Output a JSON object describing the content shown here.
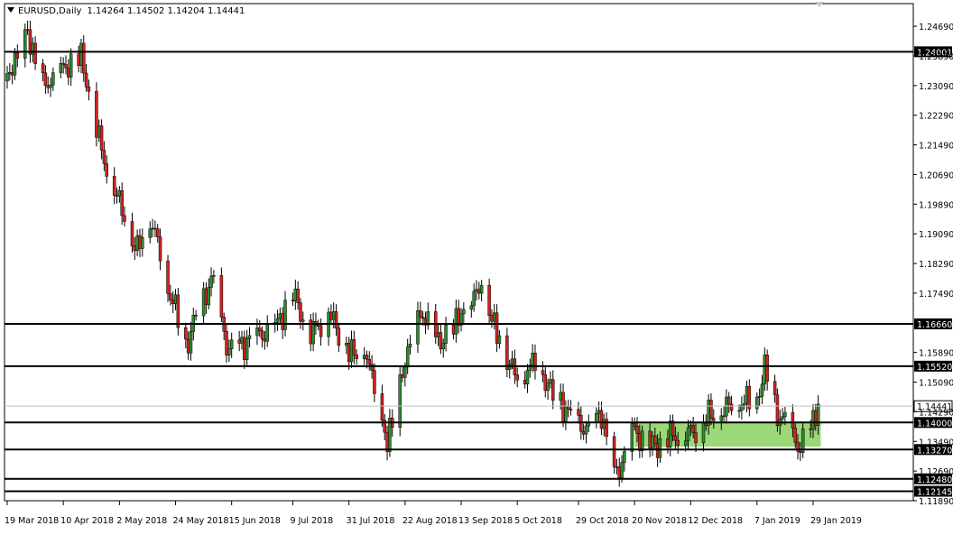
{
  "header": {
    "symbol": "EURUSD,Daily",
    "ohlc": "1.14264 1.14502 1.14204 1.14441"
  },
  "colors": {
    "bull": "#2e8b2e",
    "bear": "#d42020",
    "zone": "#90d468",
    "level": "#000000",
    "price_line": "#c0c0c0"
  },
  "chart_data": {
    "type": "candlestick",
    "ylim": [
      1.1189,
      1.253
    ],
    "y_ticks": [
      "1.24690",
      "1.23890",
      "1.23090",
      "1.22290",
      "1.21490",
      "1.20690",
      "1.19890",
      "1.19090",
      "1.18290",
      "1.17490",
      "1.15890",
      "1.15090",
      "1.14290",
      "1.13490",
      "1.12690",
      "1.11890"
    ],
    "x_ticks": [
      "19 Mar 2018",
      "10 Apr 2018",
      "2 May 2018",
      "24 May 2018",
      "15 Jun 2018",
      "9 Jul 2018",
      "31 Jul 2018",
      "22 Aug 2018",
      "13 Sep 2018",
      "5 Oct 2018",
      "29 Oct 2018",
      "20 Nov 2018",
      "12 Dec 2018",
      "7 Jan 2019",
      "29 Jan 2019"
    ],
    "levels": [
      {
        "value": 1.24001,
        "label": "1.24001"
      },
      {
        "value": 1.1666,
        "label": "1.16660"
      },
      {
        "value": 1.1552,
        "label": "1.15520"
      },
      {
        "value": 1.14,
        "label": "1.14000"
      },
      {
        "value": 1.1327,
        "label": "1.13270"
      },
      {
        "value": 1.1248,
        "label": "1.12480"
      },
      {
        "value": 1.12145,
        "label": "1.12145"
      }
    ],
    "current_price": {
      "value": 1.14441,
      "label": "1.14441"
    },
    "zone": {
      "y_top": 1.14,
      "y_bottom": 1.1335,
      "x_start": "20 Nov 2018",
      "x_end": "1 Feb 2019"
    },
    "anchors": [
      [
        "2018-03-19",
        1.233
      ],
      [
        "2018-03-27",
        1.245
      ],
      [
        "2018-04-02",
        1.23
      ],
      [
        "2018-04-10",
        1.235
      ],
      [
        "2018-04-17",
        1.238
      ],
      [
        "2018-04-26",
        1.21
      ],
      [
        "2018-05-02",
        1.199
      ],
      [
        "2018-05-09",
        1.186
      ],
      [
        "2018-05-14",
        1.196
      ],
      [
        "2018-05-21",
        1.177
      ],
      [
        "2018-05-28",
        1.161
      ],
      [
        "2018-06-07",
        1.179
      ],
      [
        "2018-06-14",
        1.159
      ],
      [
        "2018-06-21",
        1.162
      ],
      [
        "2018-07-02",
        1.166
      ],
      [
        "2018-07-09",
        1.175
      ],
      [
        "2018-07-16",
        1.164
      ],
      [
        "2018-07-23",
        1.17
      ],
      [
        "2018-07-31",
        1.159
      ],
      [
        "2018-08-07",
        1.158
      ],
      [
        "2018-08-15",
        1.134
      ],
      [
        "2018-08-22",
        1.156
      ],
      [
        "2018-08-28",
        1.169
      ],
      [
        "2018-09-05",
        1.161
      ],
      [
        "2018-09-13",
        1.169
      ],
      [
        "2018-09-21",
        1.177
      ],
      [
        "2018-09-27",
        1.164
      ],
      [
        "2018-10-05",
        1.152
      ],
      [
        "2018-10-12",
        1.157
      ],
      [
        "2018-10-19",
        1.148
      ],
      [
        "2018-10-29",
        1.14
      ],
      [
        "2018-11-02",
        1.138
      ],
      [
        "2018-11-07",
        1.143
      ],
      [
        "2018-11-12",
        1.125
      ],
      [
        "2018-11-20",
        1.138
      ],
      [
        "2018-11-26",
        1.133
      ],
      [
        "2018-12-03",
        1.136
      ],
      [
        "2018-12-12",
        1.137
      ],
      [
        "2018-12-20",
        1.142
      ],
      [
        "2018-12-31",
        1.145
      ],
      [
        "2019-01-07",
        1.146
      ],
      [
        "2019-01-10",
        1.154
      ],
      [
        "2019-01-15",
        1.142
      ],
      [
        "2019-01-21",
        1.137
      ],
      [
        "2019-01-24",
        1.132
      ],
      [
        "2019-01-31",
        1.1444
      ]
    ]
  }
}
